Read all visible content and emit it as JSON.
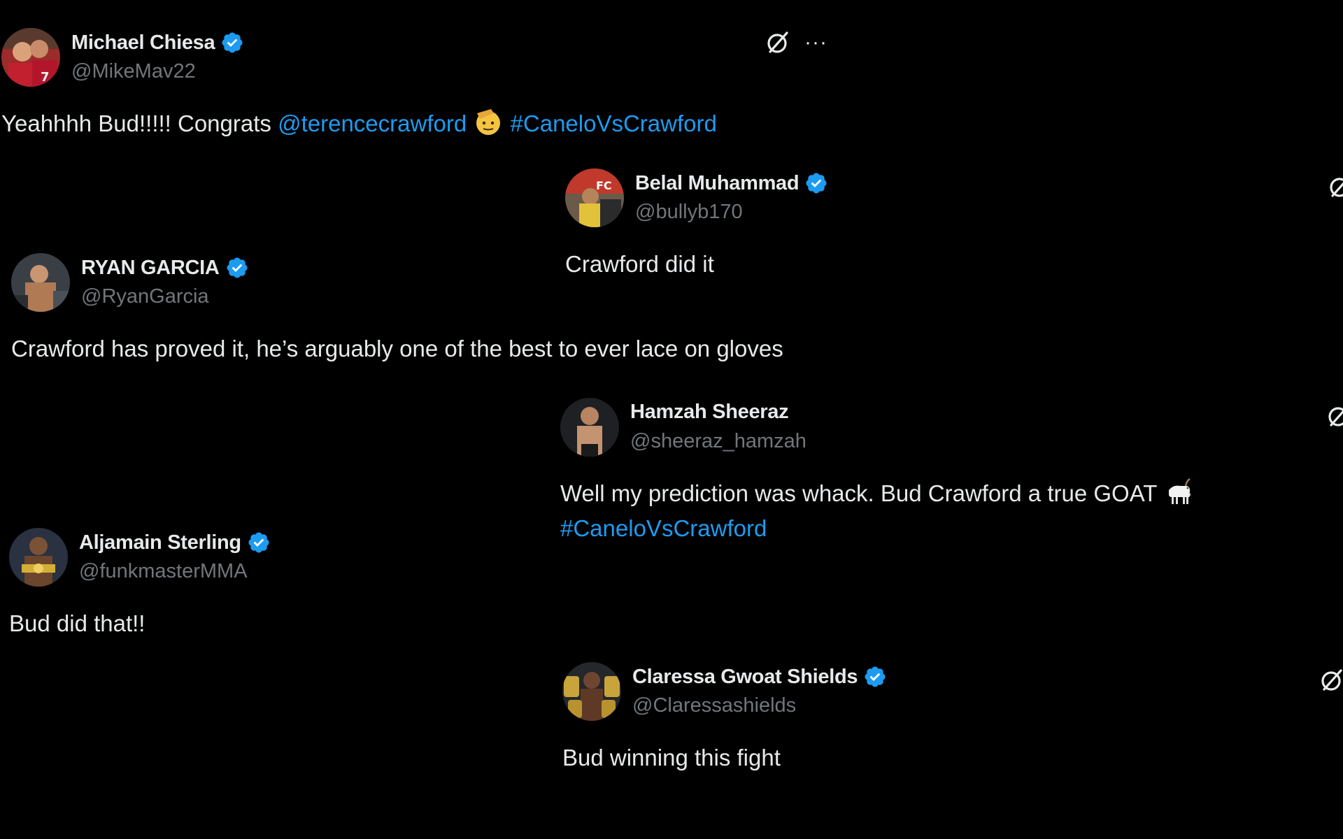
{
  "accent_color": "#1d9bf0",
  "verified_color": "#1d9bf0",
  "tweets": [
    {
      "name": "Michael Chiesa",
      "handle": "@MikeMav22",
      "verified": true,
      "text_before": "Yeahhhh Bud!!!!! Congrats ",
      "mention": "@terencecrawford",
      "emoji": "saluting-face-emoji",
      "hashtag": "#CaneloVsCrawford",
      "icons": [
        "grok-icon",
        "more-icon"
      ],
      "more_label": "···"
    },
    {
      "name": "Belal Muhammad",
      "handle": "@bullyb170",
      "verified": true,
      "text": "Crawford did it",
      "icons": [
        "grok-icon"
      ]
    },
    {
      "name": "RYAN GARCIA",
      "handle": "@RyanGarcia",
      "verified": true,
      "text": "Crawford has proved it, he’s arguably one of the best to ever lace on gloves"
    },
    {
      "name": "Hamzah Sheeraz",
      "handle": "@sheeraz_hamzah",
      "verified": false,
      "text": "Well my prediction was whack. Bud Crawford a true GOAT ",
      "emoji": "goat-emoji",
      "hashtag": "#CaneloVsCrawford",
      "icons": [
        "grok-icon"
      ]
    },
    {
      "name": "Aljamain Sterling",
      "handle": "@funkmasterMMA",
      "verified": true,
      "text": "Bud did that!!"
    },
    {
      "name": "Claressa Gwoat Shields",
      "handle": "@Claressashields",
      "verified": true,
      "text": "Bud winning this fight",
      "icons": [
        "grok-icon"
      ]
    }
  ]
}
